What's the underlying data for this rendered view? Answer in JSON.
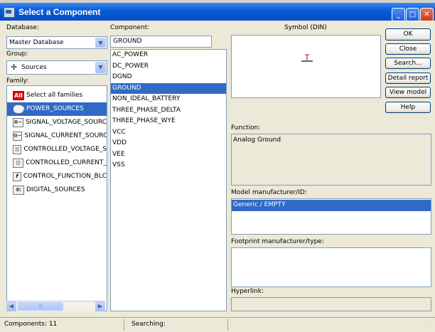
{
  "window": {
    "title": "Select a Component"
  },
  "database": {
    "label": "Database:",
    "value": "Master Database"
  },
  "group": {
    "label": "Group:",
    "value": "Sources"
  },
  "family": {
    "label": "Family:",
    "items": [
      {
        "icon": "All",
        "label": "Select all families"
      },
      {
        "icon": "PWR",
        "label": "POWER_SOURCES"
      },
      {
        "icon": "Φ~",
        "label": "SIGNAL_VOLTAGE_SOURC"
      },
      {
        "icon": "Θ~",
        "label": "SIGNAL_CURRENT_SOURC"
      },
      {
        "icon": "¦◊",
        "label": "CONTROLLED_VOLTAGE_S"
      },
      {
        "icon": "¦◊",
        "label": "CONTROLLED_CURRENT_"
      },
      {
        "icon": "f",
        "label": "CONTROL_FUNCTION_BLC"
      },
      {
        "icon": "Φ¦",
        "label": "DIGITAL_SOURCES"
      }
    ],
    "selected": "POWER_SOURCES"
  },
  "component": {
    "label": "Component:",
    "search_value": "GROUND",
    "items": [
      "AC_POWER",
      "DC_POWER",
      "DGND",
      "GROUND",
      "NON_IDEAL_BATTERY",
      "THREE_PHASE_DELTA",
      "THREE_PHASE_WYE",
      "VCC",
      "VDD",
      "VEE",
      "VSS"
    ],
    "selected": "GROUND"
  },
  "symbol": {
    "label": "Symbol (DIN)"
  },
  "buttons": {
    "ok": "OK",
    "close": "Close",
    "search": "Search...",
    "detail_report": "Detail report",
    "view_model": "View model",
    "help": "Help"
  },
  "function": {
    "label": "Function:",
    "value": "Analog Ground"
  },
  "model": {
    "label": "Model manufacturer/ID:",
    "value": "Generic / EMPTY"
  },
  "footprint": {
    "label": "Footprint manufacturer/type:"
  },
  "hyperlink": {
    "label": "Hyperlink:"
  },
  "status": {
    "components": "Components: 11",
    "searching": "Searching:"
  },
  "icons": {
    "app": "component-window-icon",
    "minimize": "minimize-icon",
    "maximize": "maximize-icon",
    "close": "close-icon"
  }
}
